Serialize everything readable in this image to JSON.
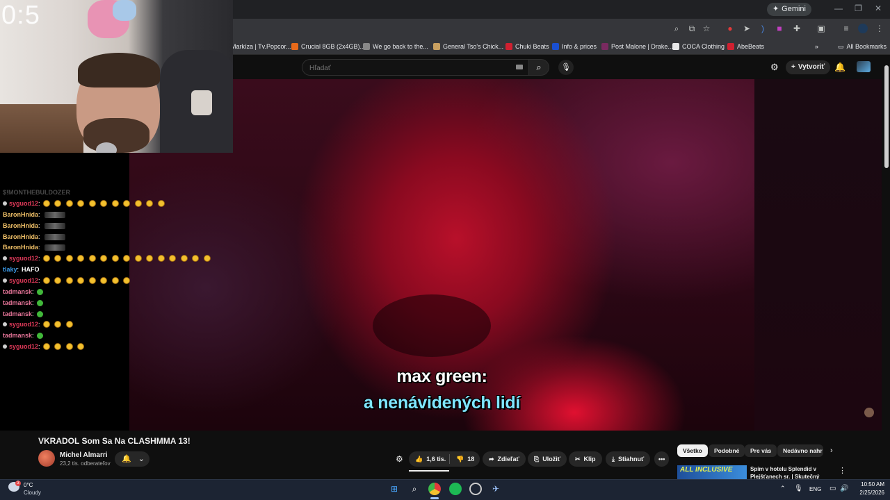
{
  "browser": {
    "gemini_label": "Gemini",
    "bookmarks": [
      {
        "label": "Markíza | Tv.Popcor...",
        "color": "#444444"
      },
      {
        "label": "Crucial 8GB (2x4GB)...",
        "color": "#e86a1a"
      },
      {
        "label": "We go back to the...",
        "color": "#888888"
      },
      {
        "label": "General Tso's Chick...",
        "color": "#c8a060"
      },
      {
        "label": "Chuki Beats",
        "color": "#d02030"
      },
      {
        "label": "Info & prices",
        "color": "#1a4fd0"
      },
      {
        "label": "Post Malone | Drake...",
        "color": "#7a2a60"
      },
      {
        "label": "COCA Clothing",
        "color": "#e8e8e8"
      },
      {
        "label": "AbeBeats",
        "color": "#d02030"
      }
    ],
    "all_bookmarks_label": "All Bookmarks"
  },
  "youtube": {
    "search_placeholder": "Hľadať",
    "create_label": "Vytvoriť",
    "subtitle_line1": "max green:",
    "subtitle_line2": "a nenávidených lidí",
    "video_title": "VKRADOL Som Sa Na CLASHMMA 13!",
    "channel_name": "Michel Almarri",
    "channel_subscribers": "23,2 tis. odberateľov",
    "actions": {
      "likes": "1,6 tis.",
      "dislikes": "18",
      "share": "Zdieľať",
      "save": "Uložiť",
      "clip": "Klip",
      "download": "Stiahnuť"
    },
    "chips": [
      "Všetko",
      "Podobné",
      "Pre vás",
      "Nedávno nahr"
    ],
    "recommended": {
      "thumb_text": "ALL INCLUSIVE",
      "title": "Spím v hotelu Splendid v Plejšťanech sr. | Skutečný All"
    }
  },
  "stream": {
    "timer": "0:5",
    "chat_header": "$!MONTHEBULDOZER",
    "chat": [
      {
        "user": "syguod12",
        "color": "#e23a5a",
        "badge": true,
        "emotes": 11,
        "type": "yellow"
      },
      {
        "user": "BaronHnida",
        "color": "#f0c068",
        "badge": false,
        "emotes": 1,
        "type": "wave"
      },
      {
        "user": "BaronHnida",
        "color": "#f0c068",
        "badge": false,
        "emotes": 1,
        "type": "wave"
      },
      {
        "user": "BaronHnida",
        "color": "#f0c068",
        "badge": false,
        "emotes": 1,
        "type": "wave"
      },
      {
        "user": "BaronHnida",
        "color": "#f0c068",
        "badge": false,
        "emotes": 1,
        "type": "wave"
      },
      {
        "user": "syguod12",
        "color": "#e23a5a",
        "badge": true,
        "emotes": 15,
        "type": "yellow"
      },
      {
        "user": "tlaky",
        "color": "#3a9ae8",
        "badge": false,
        "text": "HAFO",
        "emotes": 0,
        "type": "text"
      },
      {
        "user": "syguod12",
        "color": "#e23a5a",
        "badge": true,
        "emotes": 8,
        "type": "yellow"
      },
      {
        "user": "tadmansk",
        "color": "#e8769a",
        "badge": false,
        "emotes": 1,
        "type": "green"
      },
      {
        "user": "tadmansk",
        "color": "#e8769a",
        "badge": false,
        "emotes": 1,
        "type": "green"
      },
      {
        "user": "tadmansk",
        "color": "#e8769a",
        "badge": false,
        "emotes": 1,
        "type": "green"
      },
      {
        "user": "syguod12",
        "color": "#e23a5a",
        "badge": true,
        "emotes": 3,
        "type": "yellow"
      },
      {
        "user": "tadmansk",
        "color": "#e8769a",
        "badge": false,
        "emotes": 1,
        "type": "green"
      },
      {
        "user": "syguod12",
        "color": "#e23a5a",
        "badge": true,
        "emotes": 4,
        "type": "yellow"
      }
    ]
  },
  "taskbar": {
    "temperature": "0°C",
    "weather": "Cloudy",
    "weather_badge": "3",
    "language": "ENG",
    "time": "10:50 AM",
    "date": "2/25/2026"
  }
}
